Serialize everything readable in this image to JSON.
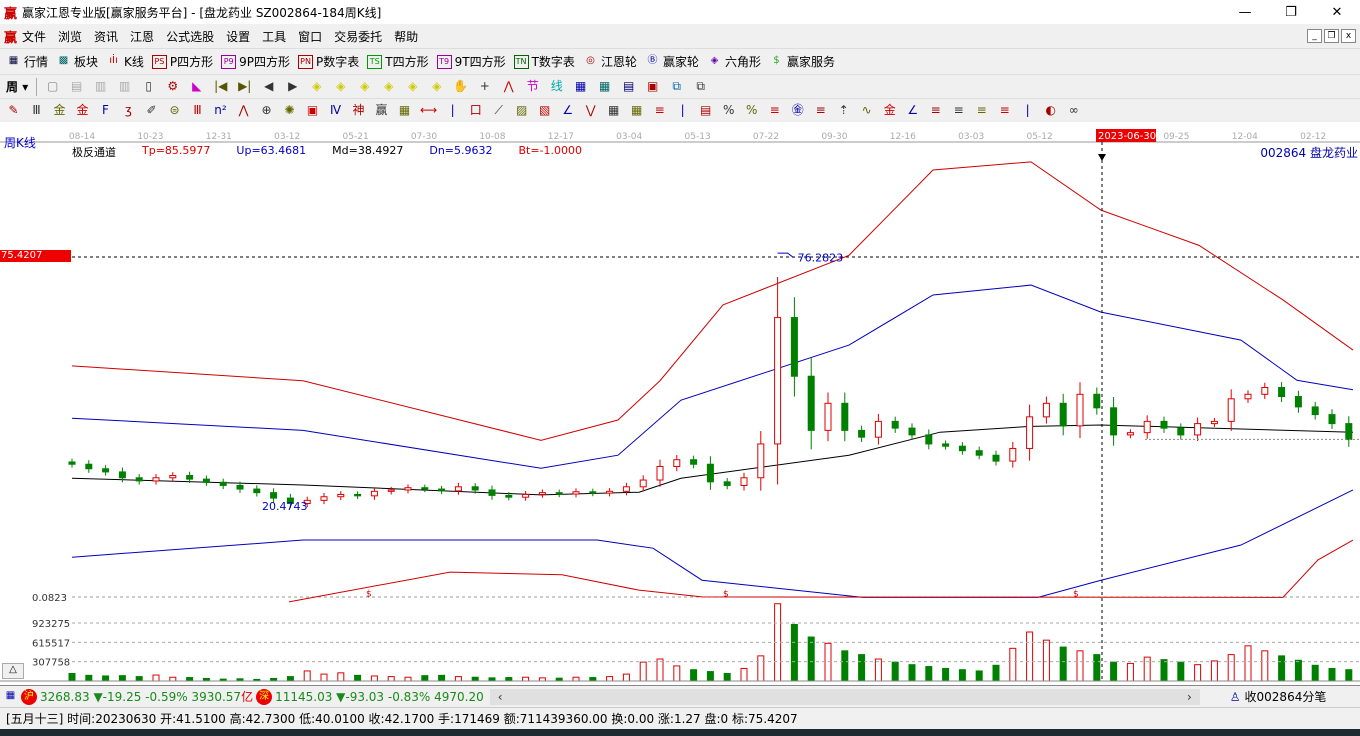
{
  "window": {
    "title": "赢家江恩专业版[赢家服务平台] - [盘龙药业  SZ002864-184周K线]",
    "min": "—",
    "restore": "❐",
    "close": "✕"
  },
  "menu": [
    "文件",
    "浏览",
    "资讯",
    "江恩",
    "公式选股",
    "设置",
    "工具",
    "窗口",
    "交易委托",
    "帮助"
  ],
  "toolbar1": [
    {
      "icon": "▦",
      "label": "行情"
    },
    {
      "icon": "▩",
      "label": "板块"
    },
    {
      "icon": "ıİı",
      "label": "K线"
    },
    {
      "icon": "PS",
      "label": "P四方形"
    },
    {
      "icon": "P9",
      "label": "9P四方形"
    },
    {
      "icon": "PN",
      "label": "P数字表"
    },
    {
      "icon": "TS",
      "label": "T四方形"
    },
    {
      "icon": "T9",
      "label": "9T四方形"
    },
    {
      "icon": "TN",
      "label": "T数字表"
    },
    {
      "icon": "◎",
      "label": "江恩轮"
    },
    {
      "icon": "Ⓑ",
      "label": "赢家轮"
    },
    {
      "icon": "◈",
      "label": "六角形"
    },
    {
      "icon": "$",
      "label": "赢家服务"
    }
  ],
  "period_select": "周",
  "chart_header": {
    "type_label": "周K线",
    "indicator": "极反通道",
    "tp": "Tp=85.5977",
    "up": "Up=63.4681",
    "md": "Md=38.4927",
    "dn": "Dn=5.9632",
    "bt": "Bt=-1.0000",
    "stock": "002864  盘龙药业"
  },
  "chart_data": {
    "type": "candlestick",
    "price_axis": {
      "min": 0.0823,
      "marker": 75.4207,
      "marker_label": "75.4207",
      "min_label": "0.0823"
    },
    "time_labels": [
      "08-14",
      "10-23",
      "12-31",
      "03-12",
      "05-21",
      "07-30",
      "10-08",
      "12-17",
      "03-04",
      "05-13",
      "07-22",
      "09-30",
      "12-16",
      "03-03",
      "05-12",
      "2023-06-30",
      "09-25",
      "12-04",
      "02-12"
    ],
    "cursor_date": "2023-06-30",
    "high_label": "76.2823",
    "low_label": "20.4743",
    "closes": [
      29.5,
      28.5,
      27.8,
      26.5,
      25.8,
      26.5,
      27,
      26.2,
      25.5,
      24.8,
      24,
      23.2,
      22,
      20.8,
      21.5,
      22.3,
      22.8,
      22.5,
      23.5,
      23.8,
      24.3,
      24,
      23.6,
      24.5,
      23.8,
      22.6,
      22.2,
      22.8,
      23.2,
      22.9,
      23.4,
      23.1,
      23.5,
      24.5,
      26,
      29,
      30.5,
      29.5,
      25.6,
      24.8,
      26.5,
      34,
      62,
      49,
      37,
      43,
      37,
      35.5,
      39,
      37.5,
      36,
      34,
      33.5,
      32.5,
      31.5,
      30.2,
      33,
      40,
      43,
      38,
      45,
      42,
      36,
      36.5,
      39,
      37.5,
      36,
      38.5,
      39,
      44,
      45,
      46.5,
      44.5,
      42.2,
      40.5,
      38.5,
      35
    ],
    "volumes": [
      120000,
      90000,
      80000,
      85000,
      70000,
      95000,
      60000,
      55000,
      40000,
      30000,
      35000,
      25000,
      40000,
      70000,
      160000,
      110000,
      130000,
      90000,
      80000,
      70000,
      60000,
      85000,
      90000,
      70000,
      60000,
      50000,
      55000,
      60000,
      50000,
      45000,
      60000,
      55000,
      70000,
      110000,
      300000,
      350000,
      240000,
      180000,
      150000,
      120000,
      200000,
      400000,
      1230000,
      900000,
      700000,
      600000,
      480000,
      420000,
      350000,
      300000,
      260000,
      230000,
      200000,
      180000,
      160000,
      250000,
      520000,
      780000,
      650000,
      540000,
      480000,
      420000,
      300000,
      280000,
      380000,
      340000,
      300000,
      260000,
      320000,
      420000,
      560000,
      480000,
      400000,
      330000,
      250000,
      200000,
      180000
    ],
    "bands": {
      "upper_red": [
        [
          0,
          51.3
        ],
        [
          33,
          48
        ],
        [
          67,
          34.8
        ],
        [
          78,
          39.3
        ],
        [
          84,
          48
        ],
        [
          93,
          64.8
        ],
        [
          111,
          75.8
        ],
        [
          123,
          94.7
        ],
        [
          137,
          96.5
        ],
        [
          147,
          85.8
        ],
        [
          161,
          78
        ],
        [
          173,
          65.9
        ],
        [
          183,
          54.8
        ]
      ],
      "upper_blue": [
        [
          0,
          39.7
        ],
        [
          33,
          37
        ],
        [
          67,
          28.6
        ],
        [
          78,
          31.5
        ],
        [
          87,
          43.7
        ],
        [
          111,
          55.9
        ],
        [
          123,
          67
        ],
        [
          137,
          69.2
        ],
        [
          147,
          63.2
        ],
        [
          167,
          57
        ],
        [
          175,
          48.1
        ],
        [
          183,
          46
        ]
      ],
      "middle": [
        [
          0,
          26.4
        ],
        [
          33,
          24.9
        ],
        [
          67,
          22.7
        ],
        [
          81,
          23.3
        ],
        [
          87,
          26.4
        ],
        [
          111,
          31.5
        ],
        [
          124,
          36.6
        ],
        [
          137,
          37.9
        ],
        [
          147,
          38.2
        ],
        [
          183,
          36.6
        ]
      ],
      "lower_blue": [
        [
          0,
          8.9
        ],
        [
          33,
          12.7
        ],
        [
          75,
          12.7
        ],
        [
          83,
          10.9
        ],
        [
          90,
          3.8
        ],
        [
          113,
          0
        ],
        [
          138,
          0
        ],
        [
          147,
          3.8
        ],
        [
          167,
          11.6
        ],
        [
          183,
          23.8
        ]
      ],
      "lower_red": [
        [
          31,
          -1
        ],
        [
          54,
          5.6
        ],
        [
          70,
          5
        ],
        [
          81,
          1.6
        ],
        [
          90,
          0.1
        ],
        [
          173,
          0
        ],
        [
          178,
          8.3
        ],
        [
          183,
          12.7
        ]
      ]
    },
    "volume_axis": {
      "ticks": [
        923275,
        615517,
        307758
      ]
    },
    "colors": {
      "up": "#e00000",
      "down": "#008000",
      "upper": "#d00000",
      "mid_blue": "#0000c0",
      "middle": "#000000"
    }
  },
  "index_bar": {
    "sh": "3268.83 ▼-19.25 -0.59% 3930.57",
    "sh_unit": "亿",
    "sz": "11145.03 ▼-93.03 -0.83% 4970.20",
    "sh_badge": "沪",
    "sz_badge": "深",
    "left": "‹",
    "right": "›",
    "ticker": "收002864分笔"
  },
  "status": "[五月十三] 时间:20230630 开:41.5100 高:42.7300 低:40.0100 收:42.1700 手:171469 额:711439360.00 换:0.00 涨:1.27 盘:0 标:75.4207",
  "collapse_btn": "△"
}
